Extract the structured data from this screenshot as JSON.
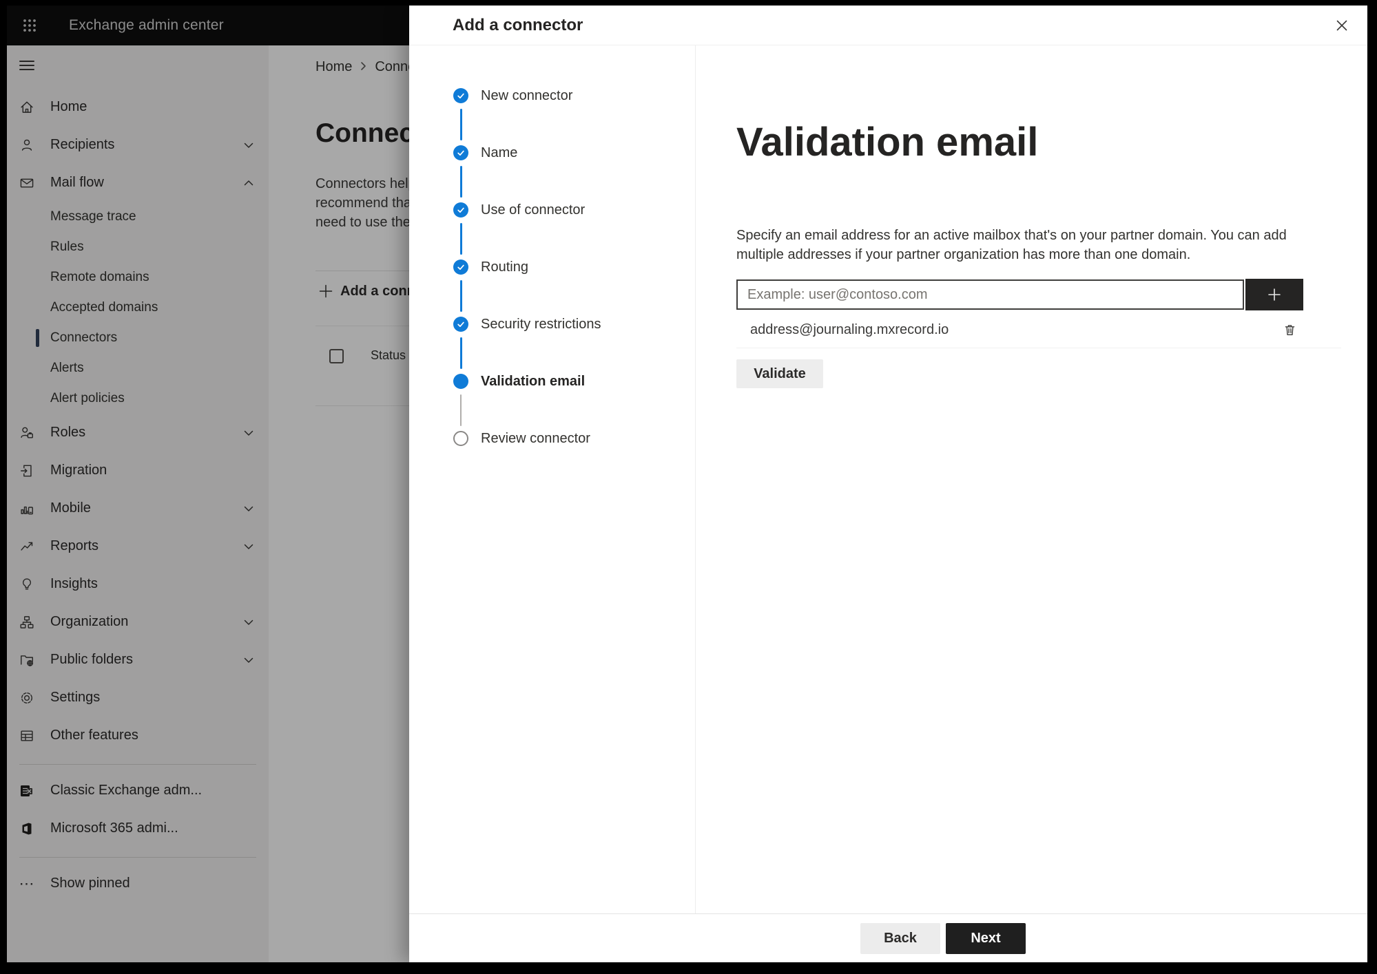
{
  "topbar": {
    "app_title": "Exchange admin center"
  },
  "sidebar": {
    "items": [
      {
        "label": "Home",
        "icon": "home-icon",
        "indent": false,
        "chevron": null,
        "selected": false
      },
      {
        "label": "Recipients",
        "icon": "person-icon",
        "indent": false,
        "chevron": "down",
        "selected": false
      },
      {
        "label": "Mail flow",
        "icon": "mail-icon",
        "indent": false,
        "chevron": "up",
        "selected": false
      },
      {
        "label": "Message trace",
        "icon": null,
        "indent": true,
        "chevron": null,
        "selected": false
      },
      {
        "label": "Rules",
        "icon": null,
        "indent": true,
        "chevron": null,
        "selected": false
      },
      {
        "label": "Remote domains",
        "icon": null,
        "indent": true,
        "chevron": null,
        "selected": false
      },
      {
        "label": "Accepted domains",
        "icon": null,
        "indent": true,
        "chevron": null,
        "selected": false
      },
      {
        "label": "Connectors",
        "icon": null,
        "indent": true,
        "chevron": null,
        "selected": true
      },
      {
        "label": "Alerts",
        "icon": null,
        "indent": true,
        "chevron": null,
        "selected": false
      },
      {
        "label": "Alert policies",
        "icon": null,
        "indent": true,
        "chevron": null,
        "selected": false
      },
      {
        "label": "Roles",
        "icon": "roles-icon",
        "indent": false,
        "chevron": "down",
        "selected": false
      },
      {
        "label": "Migration",
        "icon": "migration-icon",
        "indent": false,
        "chevron": null,
        "selected": false
      },
      {
        "label": "Mobile",
        "icon": "mobile-icon",
        "indent": false,
        "chevron": "down",
        "selected": false
      },
      {
        "label": "Reports",
        "icon": "reports-icon",
        "indent": false,
        "chevron": "down",
        "selected": false
      },
      {
        "label": "Insights",
        "icon": "insights-icon",
        "indent": false,
        "chevron": null,
        "selected": false
      },
      {
        "label": "Organization",
        "icon": "organization-icon",
        "indent": false,
        "chevron": "down",
        "selected": false
      },
      {
        "label": "Public folders",
        "icon": "public-folders-icon",
        "indent": false,
        "chevron": "down",
        "selected": false
      },
      {
        "label": "Settings",
        "icon": "settings-icon",
        "indent": false,
        "chevron": null,
        "selected": false
      },
      {
        "label": "Other features",
        "icon": "other-features-icon",
        "indent": false,
        "chevron": null,
        "selected": false
      }
    ],
    "external_links": [
      {
        "label": "Classic Exchange adm...",
        "icon": "classic-exchange-logo"
      },
      {
        "label": "Microsoft 365 admi...",
        "icon": "microsoft-365-logo"
      }
    ],
    "show_pinned_label": "Show pinned"
  },
  "page": {
    "breadcrumb": {
      "home": "Home",
      "current": "Conne"
    },
    "title": "Connec",
    "description_lines": [
      "Connectors help",
      "recommend that",
      "need to use ther"
    ],
    "add_button_label": "Add a conn",
    "table": {
      "status_header": "Status"
    }
  },
  "panel": {
    "title": "Add a connector",
    "steps": [
      {
        "label": "New connector",
        "state": "completed"
      },
      {
        "label": "Name",
        "state": "completed"
      },
      {
        "label": "Use of connector",
        "state": "completed"
      },
      {
        "label": "Routing",
        "state": "completed"
      },
      {
        "label": "Security restrictions",
        "state": "completed"
      },
      {
        "label": "Validation email",
        "state": "current"
      },
      {
        "label": "Review connector",
        "state": "upcoming"
      }
    ],
    "content": {
      "heading": "Validation email",
      "description_line1": "Specify an email address for an active mailbox that's on your partner domain. You can add",
      "description_line2": "multiple addresses if your partner organization has more than one domain.",
      "email_input_value": "",
      "email_input_placeholder": "Example: user@contoso.com",
      "added_address": "address@journaling.mxrecord.io",
      "validate_button_label": "Validate"
    },
    "footer": {
      "back_label": "Back",
      "next_label": "Next"
    }
  },
  "colors": {
    "accent_blue": "#0f7bd7",
    "pending_step_gray": "#8a8886",
    "topbar_bg": "#0e0e0e",
    "sidebar_bg": "#f3f2f1",
    "primary_button_bg": "#1f1f1f",
    "plus_button_bg": "#252423"
  }
}
